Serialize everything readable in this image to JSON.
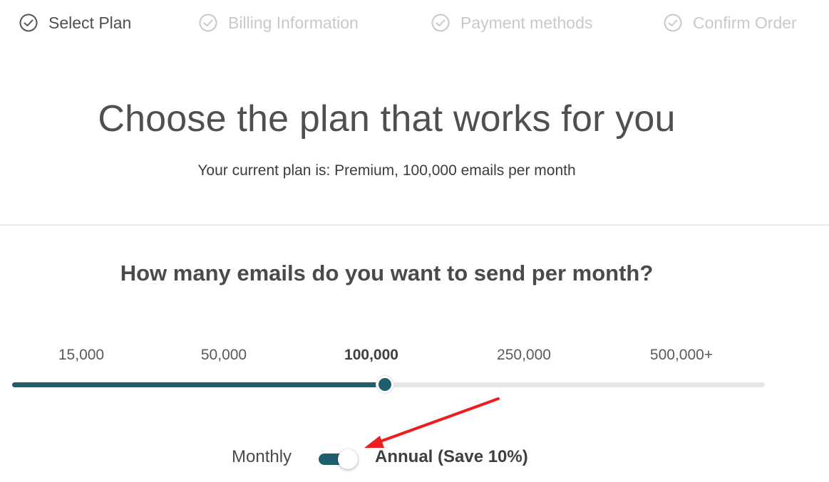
{
  "stepper": {
    "steps": [
      {
        "label": "Select Plan",
        "state": "active"
      },
      {
        "label": "Billing Information",
        "state": "inactive"
      },
      {
        "label": "Payment methods",
        "state": "inactive"
      },
      {
        "label": "Confirm Order",
        "state": "inactive"
      }
    ],
    "icon": "check-circle-icon"
  },
  "header": {
    "title": "Choose the plan that works for you",
    "current_plan": "Your current plan is: Premium, 100,000 emails per month"
  },
  "volume": {
    "question": "How many emails do you want to send per month?",
    "options": [
      "15,000",
      "50,000",
      "100,000",
      "250,000",
      "500,000+"
    ],
    "selected_index": 2
  },
  "billing": {
    "monthly_label": "Monthly",
    "annual_label": "Annual (Save 10%)",
    "annual_selected": true
  },
  "colors": {
    "accent": "#1f5f6b",
    "annotation_arrow": "#ee1c1c",
    "inactive_text": "#c9c9c9"
  }
}
